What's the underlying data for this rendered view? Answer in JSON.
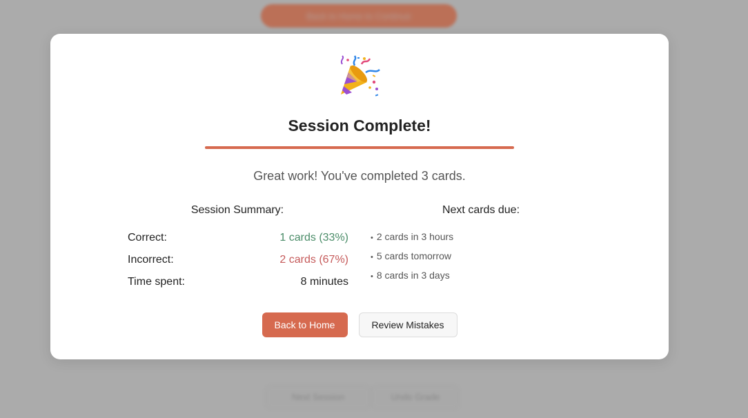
{
  "background": {
    "top_pill_label": "Back to Home to Continue",
    "bottom_buttons": [
      "Next Session",
      "Undo Grade"
    ]
  },
  "modal": {
    "emoji_icon": "party-popper-icon",
    "title": "Session Complete!",
    "subtitle": "Great work! You've completed 3 cards.",
    "summary": {
      "heading": "Session Summary:",
      "rows": [
        {
          "label": "Correct:",
          "value": "1 cards (33%)",
          "color": "#4a8c68"
        },
        {
          "label": "Incorrect:",
          "value": "2 cards (67%)",
          "color": "#c55a5a"
        },
        {
          "label": "Time spent:",
          "value": "8 minutes",
          "color": "#222222"
        }
      ]
    },
    "next_due": {
      "heading": "Next cards due:",
      "items": [
        "2 cards in 3 hours",
        "5 cards tomorrow",
        "8 cards in 3 days"
      ]
    },
    "buttons": {
      "back_home": "Back to Home",
      "review_mistakes": "Review Mistakes"
    }
  },
  "colors": {
    "accent": "#d66a4f",
    "overlay": "#ababab"
  }
}
